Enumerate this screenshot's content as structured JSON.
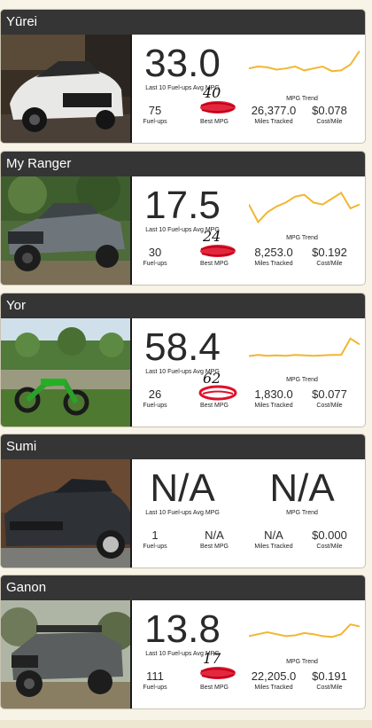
{
  "colors": {
    "header_bg": "#353535",
    "trend_line": "#f2b630",
    "scribble": "#e0102a"
  },
  "labels": {
    "avg": "Last 10 Fuel-ups Avg MPG",
    "trend": "MPG Trend",
    "fuelups": "Fuel-ups",
    "best": "Best MPG",
    "miles": "Miles Tracked",
    "cost": "Cost/Mile"
  },
  "vehicles": [
    {
      "name": "Yūrei",
      "avg_mpg": "33.0",
      "fuelups": "75",
      "best_mpg": "",
      "best_handwritten": "40",
      "miles": "26,377.0",
      "cost": "$0.078",
      "trend_na": "",
      "trend": [
        0.55,
        0.5,
        0.52,
        0.58,
        0.55,
        0.5,
        0.6,
        0.55,
        0.5,
        0.62,
        0.6,
        0.45,
        0.1
      ]
    },
    {
      "name": "My Ranger",
      "avg_mpg": "17.5",
      "fuelups": "30",
      "best_mpg": "",
      "best_handwritten": "24",
      "miles": "8,253.0",
      "cost": "$0.192",
      "trend_na": "",
      "trend": [
        0.4,
        0.85,
        0.6,
        0.45,
        0.35,
        0.2,
        0.15,
        0.35,
        0.4,
        0.25,
        0.1,
        0.5,
        0.4
      ]
    },
    {
      "name": "Yor",
      "avg_mpg": "58.4",
      "fuelups": "26",
      "best_mpg": "",
      "best_handwritten": "62",
      "miles": "1,830.0",
      "cost": "$0.077",
      "trend_na": "",
      "trend": [
        0.65,
        0.62,
        0.64,
        0.63,
        0.64,
        0.62,
        0.63,
        0.64,
        0.63,
        0.62,
        0.62,
        0.2,
        0.35
      ]
    },
    {
      "name": "Sumi",
      "avg_mpg": "N/A",
      "fuelups": "1",
      "best_mpg": "N/A",
      "best_handwritten": "",
      "miles": "N/A",
      "cost": "$0.000",
      "trend_na": "N/A",
      "trend": []
    },
    {
      "name": "Ganon",
      "avg_mpg": "13.8",
      "fuelups": "111",
      "best_mpg": "",
      "best_handwritten": "17",
      "miles": "22,205.0",
      "cost": "$0.191",
      "trend_na": "",
      "trend": [
        0.6,
        0.55,
        0.5,
        0.55,
        0.6,
        0.58,
        0.52,
        0.55,
        0.6,
        0.62,
        0.55,
        0.3,
        0.35
      ]
    }
  ]
}
